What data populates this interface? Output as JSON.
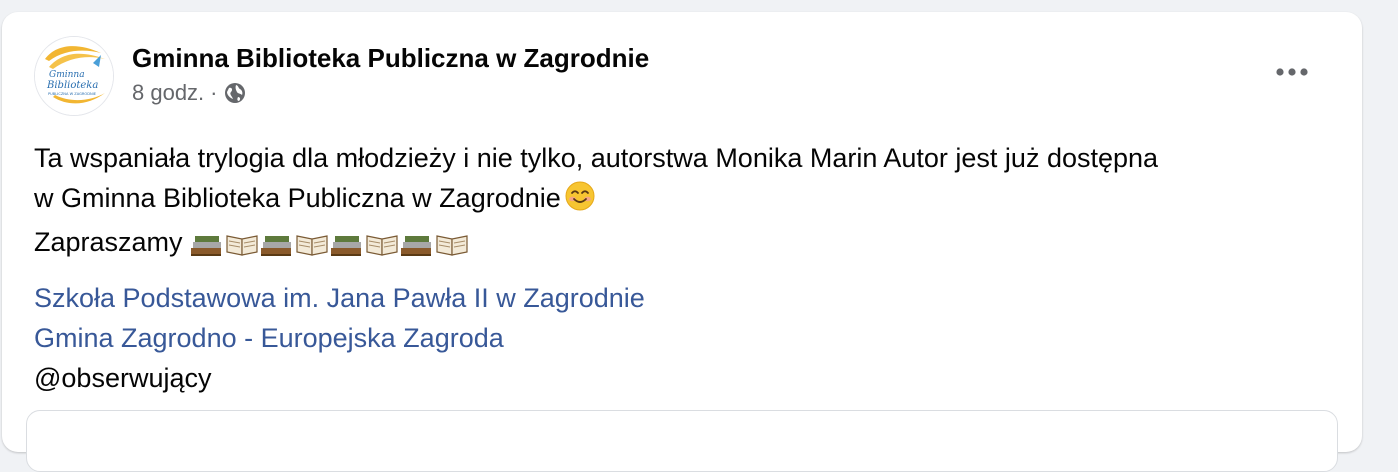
{
  "post": {
    "page_name": "Gminna Biblioteka Publiczna w Zagrodnie",
    "time": "8 godz.",
    "separator": "·",
    "avatar_logo_lines": [
      "Gminna",
      "Biblioteka",
      "PUBLICZNA W ZAGRODNIE"
    ],
    "text_line1": "Ta wspaniała trylogia dla młodzieży i nie tylko,  autorstwa Monika Marin Autor jest już dostępna",
    "text_line2": "w Gminna Biblioteka Publiczna w Zagrodnie",
    "text_line3": "Zapraszamy",
    "mentions": [
      "Szkoła Podstawowa im. Jana Pawła II w Zagrodnie",
      "Gmina Zagrodno - Europejska Zagroda"
    ],
    "followers_tag": "@obserwujący",
    "icons": {
      "privacy": "globe-icon",
      "menu": "more-options-icon",
      "emoji_smile": "smiling-face-emoji",
      "emoji_books": "books-open-book-emoji"
    },
    "colors": {
      "link": "#385898",
      "secondary_text": "#65676b",
      "primary_text": "#050505",
      "background": "#f0f2f5"
    }
  }
}
